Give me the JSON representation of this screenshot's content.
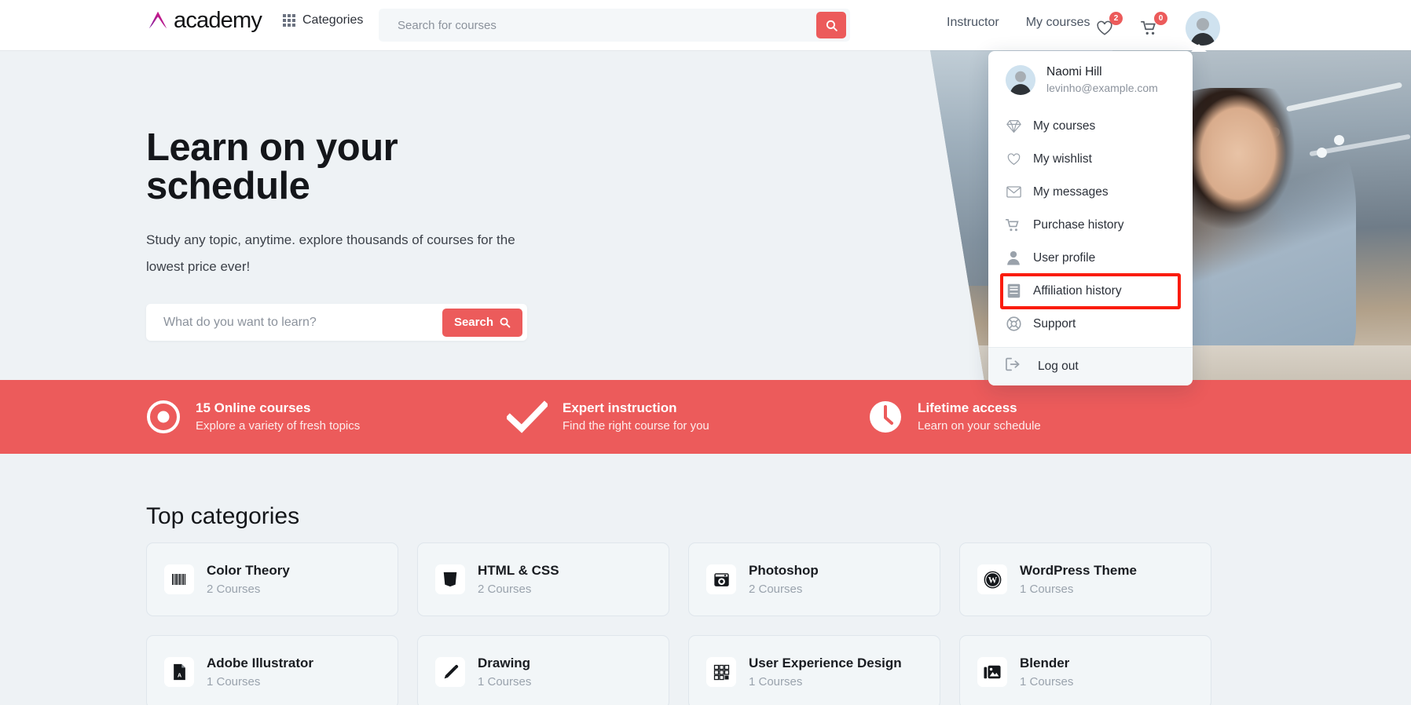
{
  "brand": {
    "logo_text": "academy",
    "accent_color": "#ec5b5b",
    "logo_color": "#b9228c"
  },
  "navbar": {
    "categories_label": "Categories",
    "search_placeholder": "Search for courses",
    "search_value": "",
    "search_icon": "search-icon",
    "links": [
      {
        "label": "Instructor"
      },
      {
        "label": "My courses"
      }
    ],
    "wishlist_badge": "2",
    "cart_badge": "0"
  },
  "hero": {
    "title_line1": "Learn on your",
    "title_line2": "schedule",
    "subtitle": "Study any topic, anytime. explore thousands of courses for the lowest price ever!",
    "search_placeholder": "What do you want to learn?",
    "search_value": "",
    "search_button": "Search"
  },
  "features": [
    {
      "icon": "target-icon",
      "title": "15 Online courses",
      "subtitle": "Explore a variety of fresh topics"
    },
    {
      "icon": "check-icon",
      "title": "Expert instruction",
      "subtitle": "Find the right course for you"
    },
    {
      "icon": "clock-icon",
      "title": "Lifetime access",
      "subtitle": "Learn on your schedule"
    }
  ],
  "categories": {
    "heading": "Top categories",
    "items": [
      {
        "name": "Color Theory",
        "count": "2 Courses",
        "icon": "barcode-icon"
      },
      {
        "name": "HTML & CSS",
        "count": "2 Courses",
        "icon": "css3-icon"
      },
      {
        "name": "Photoshop",
        "count": "2 Courses",
        "icon": "photoshop-icon"
      },
      {
        "name": "WordPress Theme",
        "count": "1 Courses",
        "icon": "wordpress-icon"
      },
      {
        "name": "Adobe Illustrator",
        "count": "1 Courses",
        "icon": "file-pdf-icon"
      },
      {
        "name": "Drawing",
        "count": "1 Courses",
        "icon": "pencil-icon"
      },
      {
        "name": "User Experience Design",
        "count": "1 Courses",
        "icon": "grid-squares-icon"
      },
      {
        "name": "Blender",
        "count": "1 Courses",
        "icon": "images-icon"
      }
    ]
  },
  "user_menu": {
    "name": "Naomi Hill",
    "email": "levinho@example.com",
    "items": [
      {
        "label": "My courses",
        "icon": "diamond-icon",
        "highlighted": false
      },
      {
        "label": "My wishlist",
        "icon": "heart-icon",
        "highlighted": false
      },
      {
        "label": "My messages",
        "icon": "envelope-icon",
        "highlighted": false
      },
      {
        "label": "Purchase history",
        "icon": "cart-icon",
        "highlighted": false
      },
      {
        "label": "User profile",
        "icon": "user-icon",
        "highlighted": false
      },
      {
        "label": "Affiliation history",
        "icon": "book-icon",
        "highlighted": true
      },
      {
        "label": "Support",
        "icon": "lifebuoy-icon",
        "highlighted": false
      }
    ],
    "logout_label": "Log out",
    "logout_icon": "logout-icon",
    "highlight_color": "#fa1c0c"
  }
}
